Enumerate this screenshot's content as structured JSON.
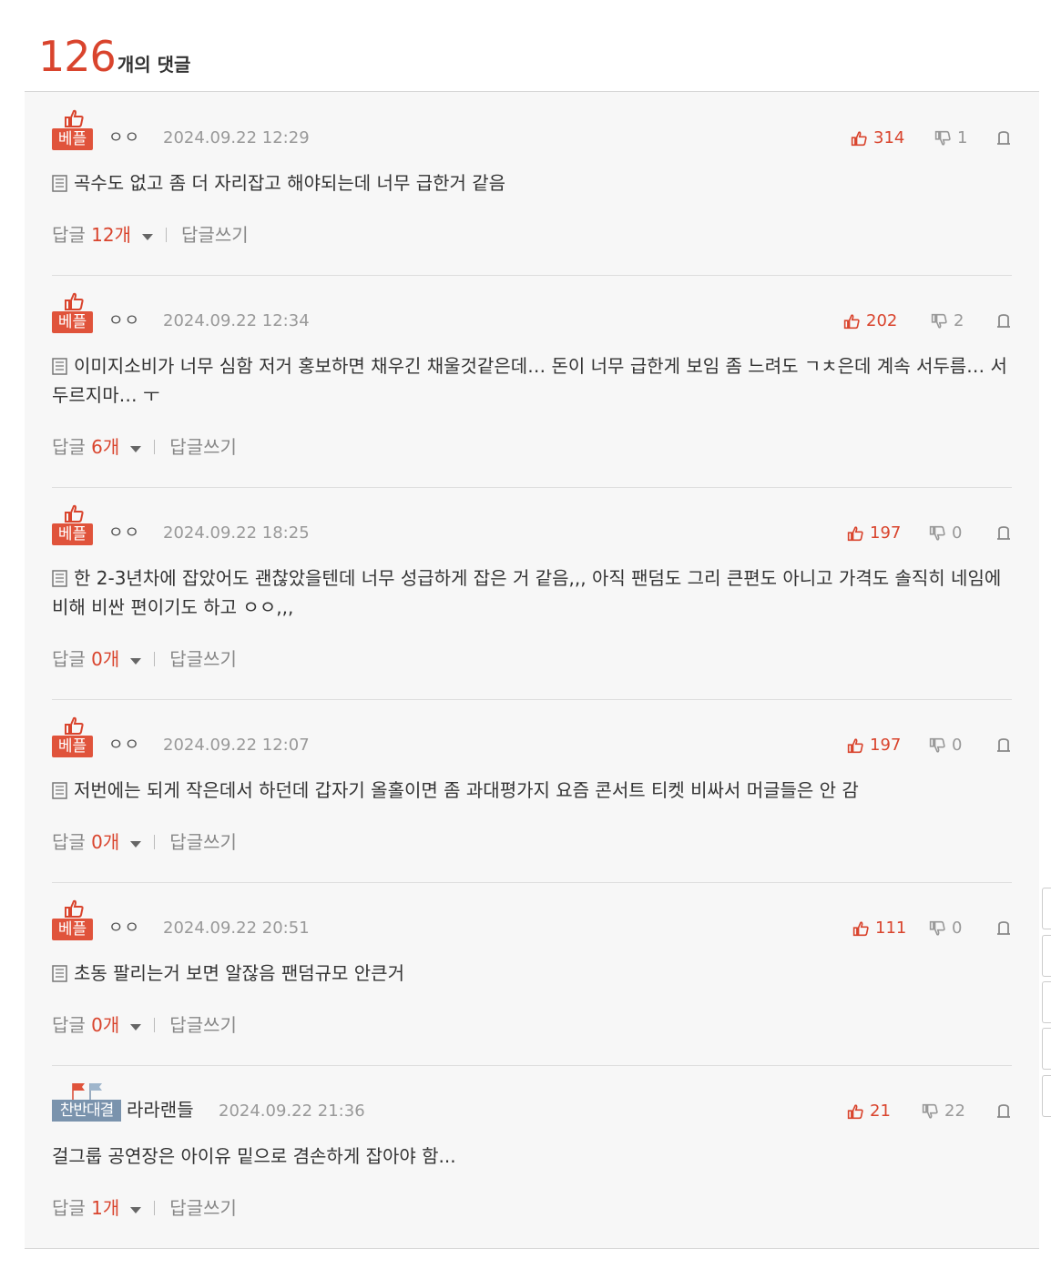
{
  "header": {
    "count": "126",
    "label": "개의 댓글"
  },
  "comments": [
    {
      "badge": "베플",
      "nick": "ㅇㅇ",
      "date": "2024.09.22 12:29",
      "up": "314",
      "down": "1",
      "text": "곡수도 없고 좀 더 자리잡고 해야되는데 너무 급한거 같음",
      "reply_label": "답글",
      "reply_count": "12개",
      "reply_write": "답글쓰기"
    },
    {
      "badge": "베플",
      "nick": "ㅇㅇ",
      "date": "2024.09.22 12:34",
      "up": "202",
      "down": "2",
      "text": "이미지소비가 너무 심함 저거 홍보하면 채우긴 채울것같은데… 돈이 너무 급한게 보임 좀 느려도 ㄱㅊ은데 계속 서두름… 서두르지마… ㅜ",
      "reply_label": "답글",
      "reply_count": "6개",
      "reply_write": "답글쓰기"
    },
    {
      "badge": "베플",
      "nick": "ㅇㅇ",
      "date": "2024.09.22 18:25",
      "up": "197",
      "down": "0",
      "text": "한 2-3년차에 잡았어도 괜찮았을텐데 너무 성급하게 잡은 거 같음,,, 아직 팬덤도 그리 큰편도 아니고 가격도 솔직히 네임에 비해 비싼 편이기도 하고 ㅇㅇ,,,",
      "reply_label": "답글",
      "reply_count": "0개",
      "reply_write": "답글쓰기"
    },
    {
      "badge": "베플",
      "nick": "ㅇㅇ",
      "date": "2024.09.22 12:07",
      "up": "197",
      "down": "0",
      "text": "저번에는 되게 작은데서 하던데 갑자기 올홀이면 좀 과대평가지 요즘 콘서트 티켓 비싸서 머글들은 안 감",
      "reply_label": "답글",
      "reply_count": "0개",
      "reply_write": "답글쓰기"
    },
    {
      "badge": "베플",
      "nick": "ㅇㅇ",
      "date": "2024.09.22 20:51",
      "up": "111",
      "down": "0",
      "text": "초동 팔리는거 보면 알잖음 팬덤규모 안큰거",
      "reply_label": "답글",
      "reply_count": "0개",
      "reply_write": "답글쓰기"
    },
    {
      "badge": "찬반대결",
      "nick": "라라랜들",
      "date": "2024.09.22 21:36",
      "up": "21",
      "down": "22",
      "text": "걸그룹 공연장은 아이유 밑으로 겸손하게 잡아야 함...",
      "reply_label": "답글",
      "reply_count": "1개",
      "reply_write": "답글쓰기"
    }
  ],
  "colors": {
    "accent": "#d9442d",
    "badge_blue": "#7a93ad",
    "panel_bg": "#f7f7f7"
  },
  "icons": {
    "best": "thumbs-up-icon",
    "up": "thumbs-up-icon",
    "down": "thumbs-down-icon",
    "report": "report-icon",
    "doc": "document-icon",
    "flags": "flags-icon"
  }
}
